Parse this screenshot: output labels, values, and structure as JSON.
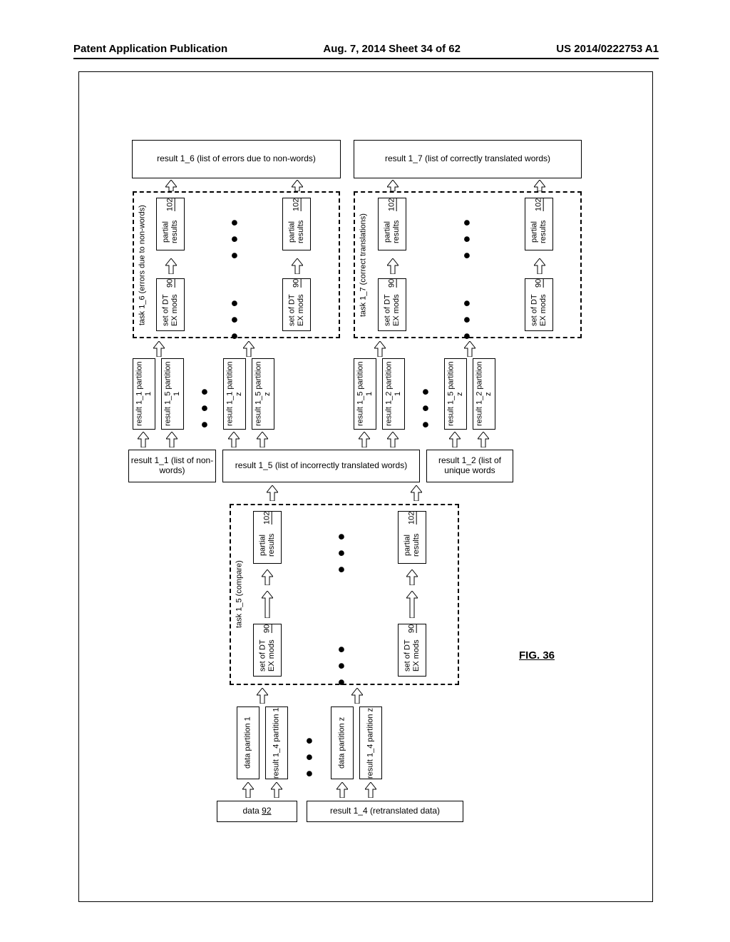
{
  "header": {
    "left": "Patent Application Publication",
    "center": "Aug. 7, 2014  Sheet 34 of 62",
    "right": "US 2014/0222753 A1"
  },
  "figure": "FIG. 36",
  "boxes": {
    "result16": "result 1_6 (list of errors due to non-words)",
    "result17": "result 1_7 (list of correctly translated words)",
    "partial102": "partial results",
    "partial102_ref": "102",
    "setDT90": "set of DT EX mods",
    "setDT90_ref": "90",
    "task16": "task 1_6 (errors due to non-words)",
    "task17": "task 1_7 (correct translations)",
    "task15": "task 1_5 (compare)",
    "result11": "result 1_1 (list of non-words)",
    "result15": "result 1_5 (list of incorrectly translated words)",
    "result12": "result 1_2 (list of unique words",
    "r11p1": "result 1_1 partition 1",
    "r15p1": "result 1_5 partition 1",
    "r11pz": "result 1_1 partition z",
    "r15pz": "result 1_5 partition z",
    "r12p1": "result 1_2 partition 1",
    "r12pz": "result 1_2 partition z",
    "data92": "data",
    "data92_ref": "92",
    "result14": "result 1_4 (retranslated data)",
    "datap1": "data partition 1",
    "r14p1": "result 1_4 partition 1",
    "datapz": "data partition z",
    "r14pz": "result 1_4 partition z"
  },
  "dots": "●●●"
}
